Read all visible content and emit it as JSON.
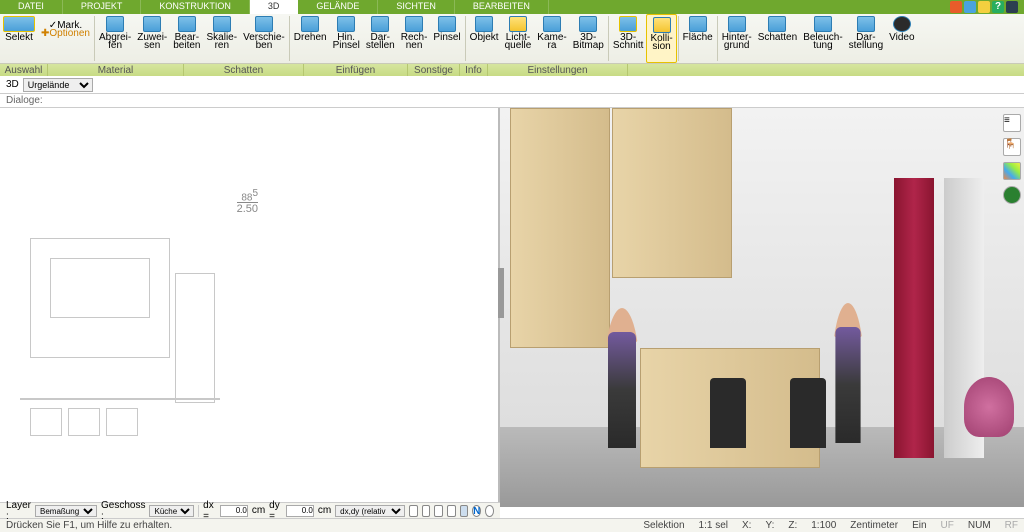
{
  "tabs": [
    "DATEI",
    "PROJEKT",
    "KONSTRUKTION",
    "3D",
    "GELÄNDE",
    "SICHTEN",
    "BEARBEITEN"
  ],
  "active_tab": 3,
  "ribbon": {
    "auswahl": {
      "selekt": "Selekt",
      "mark": "Mark.",
      "optionen": "Optionen"
    },
    "material": {
      "abgreifen": "Abgrei-\nfen",
      "zuweisen": "Zuwei-\nsen",
      "bearbeiten": "Bear-\nbeiten",
      "skalieren": "Skalie-\nren",
      "verschieben": "Verschie-\nben"
    },
    "schatten": {
      "drehen": "Drehen",
      "hinpinsel": "Hin.\nPinsel",
      "darstellen": "Dar-\nstellen",
      "rechnen": "Rech-\nnen",
      "pinsel": "Pinsel"
    },
    "einfuegen": {
      "objekt": "Objekt",
      "lichtquelle": "Licht-\nquelle",
      "kamera": "Kame-\nra",
      "bitmap": "3D-\nBitmap"
    },
    "sonstige": {
      "schnitt": "3D-\nSchnitt",
      "kollision": "Kolli-\nsion"
    },
    "info": {
      "flaeche": "Fläche"
    },
    "einstellungen": {
      "hintergrund": "Hinter-\ngrund",
      "schatten2": "Schatten",
      "beleuchtung": "Beleuch-\ntung",
      "darstellung": "Dar-\nstellung",
      "video": "Video"
    }
  },
  "group_labels": [
    "Auswahl",
    "Material",
    "Schatten",
    "Einfügen",
    "Sonstige",
    "Info",
    "Einstellungen"
  ],
  "subbar": {
    "mode": "3D",
    "dropdown": "Urgelände"
  },
  "dialogs_label": "Dialoge:",
  "plan_dims": {
    "a": "88",
    "b": "2.50",
    "sup": "5"
  },
  "layerbar": {
    "layer_label": "Layer :",
    "layer_value": "Bemaßung",
    "geschoss_label": "Geschoss :",
    "geschoss_value": "Küche",
    "dx_label": "dx =",
    "dx_value": "0.0",
    "cm": "cm",
    "dy_label": "dy =",
    "dy_value": "0.0",
    "mode": "dx,dy (relativ ka",
    "n_icon": "N"
  },
  "status": {
    "hint": "Drücken Sie F1, um Hilfe zu erhalten.",
    "selektion": "Selektion",
    "sel": "1:1 sel",
    "x": "X:",
    "y": "Y:",
    "z": "Z:",
    "scale": "1:100",
    "unit": "Zentimeter",
    "ein": "Ein",
    "uf": "UF",
    "num": "NUM",
    "rf": "RF"
  }
}
